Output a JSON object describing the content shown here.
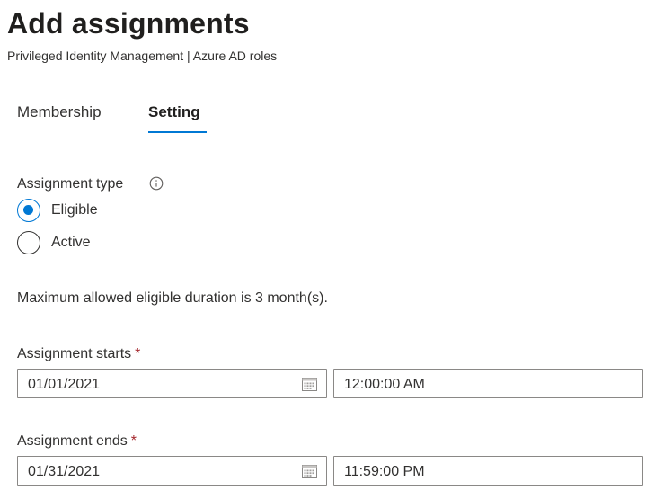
{
  "header": {
    "title": "Add assignments",
    "subtitle": "Privileged Identity Management | Azure AD roles"
  },
  "tabs": [
    {
      "label": "Membership",
      "selected": false
    },
    {
      "label": "Setting",
      "selected": true
    }
  ],
  "assignment_type": {
    "label": "Assignment type",
    "info_icon": "info-icon",
    "options": [
      {
        "label": "Eligible",
        "checked": true
      },
      {
        "label": "Active",
        "checked": false
      }
    ]
  },
  "duration_note": "Maximum allowed eligible duration is 3 month(s).",
  "assignment_starts": {
    "label": "Assignment starts",
    "required_marker": "*",
    "date": "01/01/2021",
    "time": "12:00:00 AM"
  },
  "assignment_ends": {
    "label": "Assignment ends",
    "required_marker": "*",
    "date": "01/31/2021",
    "time": "11:59:00 PM"
  },
  "colors": {
    "accent": "#0078d4",
    "required": "#a4262c",
    "text": "#323130",
    "border": "#8a8886"
  }
}
